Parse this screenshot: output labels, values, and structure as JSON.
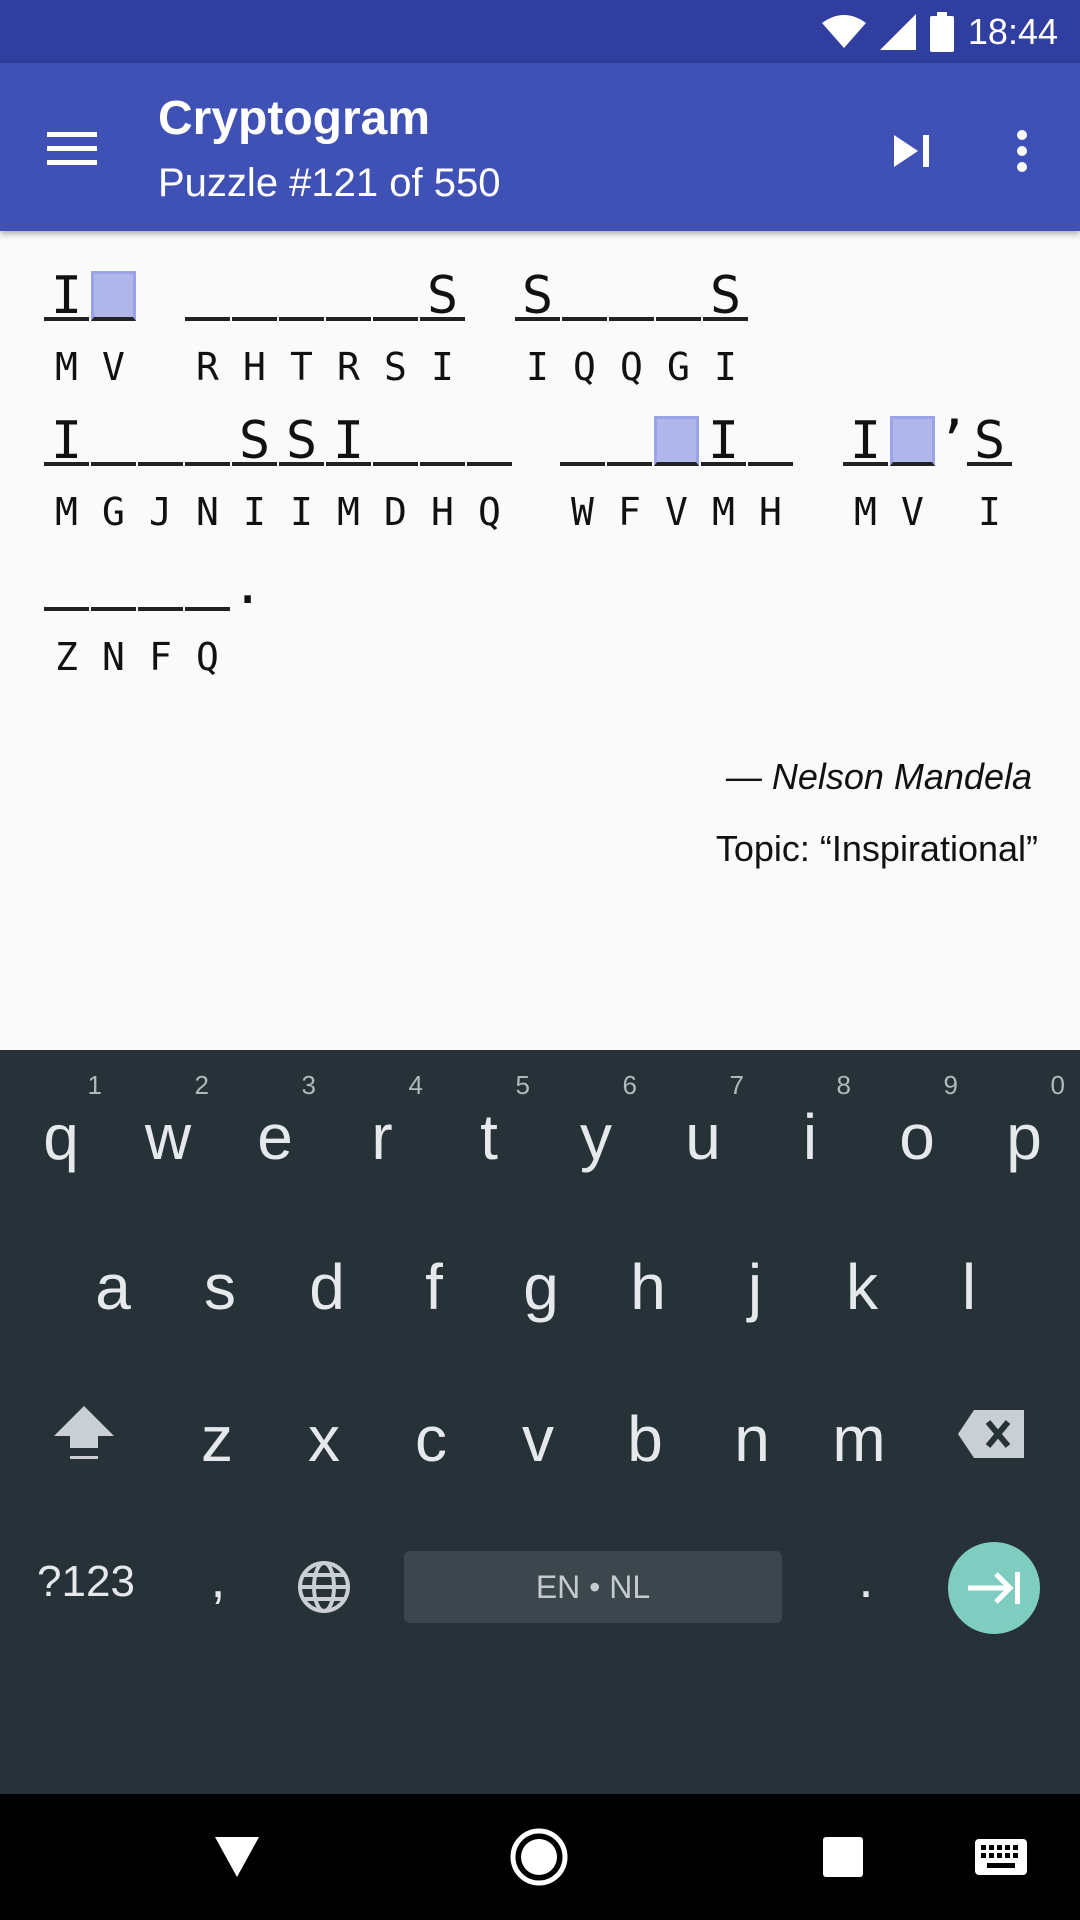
{
  "status_bar": {
    "time": "18:44"
  },
  "app_bar": {
    "title": "Cryptogram",
    "subtitle": "Puzzle #121 of 550",
    "icons": [
      "menu-icon",
      "skip-next-icon",
      "more-vert-icon"
    ]
  },
  "puzzle": {
    "lines": [
      {
        "words": [
          {
            "cells": [
              {
                "letter": "I",
                "code": "M"
              },
              {
                "letter": "",
                "code": "V",
                "highlight": true
              }
            ]
          },
          {
            "cells": [
              {
                "letter": "",
                "code": "R"
              },
              {
                "letter": "",
                "code": "H"
              },
              {
                "letter": "",
                "code": "T"
              },
              {
                "letter": "",
                "code": "R"
              },
              {
                "letter": "",
                "code": "S"
              },
              {
                "letter": "S",
                "code": "I"
              }
            ]
          },
          {
            "cells": [
              {
                "letter": "S",
                "code": "I"
              },
              {
                "letter": "",
                "code": "Q"
              },
              {
                "letter": "",
                "code": "Q"
              },
              {
                "letter": "",
                "code": "G"
              },
              {
                "letter": "S",
                "code": "I"
              }
            ]
          }
        ]
      },
      {
        "words": [
          {
            "cells": [
              {
                "letter": "I",
                "code": "M"
              },
              {
                "letter": "",
                "code": "G"
              },
              {
                "letter": "",
                "code": "J"
              },
              {
                "letter": "",
                "code": "N"
              },
              {
                "letter": "S",
                "code": "I"
              },
              {
                "letter": "S",
                "code": "I"
              },
              {
                "letter": "I",
                "code": "M"
              },
              {
                "letter": "",
                "code": "D"
              },
              {
                "letter": "",
                "code": "H"
              },
              {
                "letter": "",
                "code": "Q"
              }
            ]
          },
          {
            "cells": [
              {
                "letter": "",
                "code": "W"
              },
              {
                "letter": "",
                "code": "F"
              },
              {
                "letter": "",
                "code": "V",
                "highlight": true
              },
              {
                "letter": "I",
                "code": "M"
              },
              {
                "letter": "",
                "code": "H"
              }
            ]
          },
          {
            "cells": [
              {
                "letter": "I",
                "code": "M"
              },
              {
                "letter": "",
                "code": "V",
                "highlight": true
              },
              {
                "letter": "’",
                "code": "",
                "punct": true
              },
              {
                "letter": "S",
                "code": "I"
              }
            ]
          }
        ]
      },
      {
        "words": [
          {
            "cells": [
              {
                "letter": "",
                "code": "Z"
              },
              {
                "letter": "",
                "code": "N"
              },
              {
                "letter": "",
                "code": "F"
              },
              {
                "letter": "",
                "code": "Q"
              },
              {
                "letter": ".",
                "code": "",
                "punct": true
              }
            ]
          }
        ]
      }
    ],
    "author": "— Nelson Mandela",
    "topic": "Topic: “Inspirational”"
  },
  "keyboard": {
    "row1": [
      {
        "char": "q",
        "hint": "1"
      },
      {
        "char": "w",
        "hint": "2"
      },
      {
        "char": "e",
        "hint": "3"
      },
      {
        "char": "r",
        "hint": "4"
      },
      {
        "char": "t",
        "hint": "5"
      },
      {
        "char": "y",
        "hint": "6"
      },
      {
        "char": "u",
        "hint": "7"
      },
      {
        "char": "i",
        "hint": "8"
      },
      {
        "char": "o",
        "hint": "9"
      },
      {
        "char": "p",
        "hint": "0"
      }
    ],
    "row2": [
      "a",
      "s",
      "d",
      "f",
      "g",
      "h",
      "j",
      "k",
      "l"
    ],
    "row3": [
      "z",
      "x",
      "c",
      "v",
      "b",
      "n",
      "m"
    ],
    "symbols_label": "?123",
    "comma": ",",
    "space_label": "EN • NL",
    "period": "."
  },
  "nav_bar": {
    "icons": [
      "back-icon",
      "home-icon",
      "recents-icon",
      "keyboard-icon"
    ]
  }
}
